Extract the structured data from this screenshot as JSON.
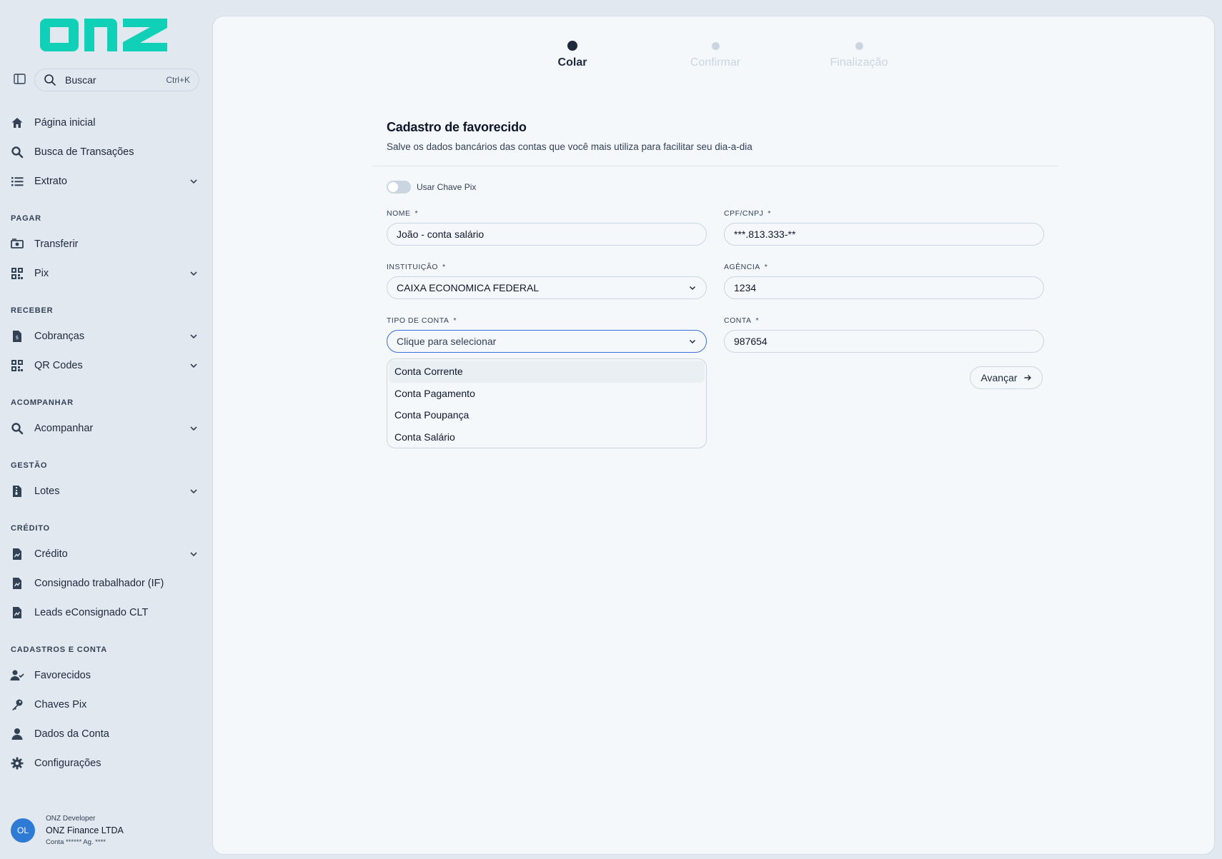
{
  "brand": {
    "logo_text": "onz",
    "logo_color": "#10d0b8"
  },
  "search": {
    "label": "Buscar",
    "shortcut": "Ctrl+K"
  },
  "sidebar": {
    "items_top": [
      {
        "label": "Página inicial",
        "icon": "home-icon"
      },
      {
        "label": "Busca de Transações",
        "icon": "search-icon"
      },
      {
        "label": "Extrato",
        "icon": "list-icon",
        "expandable": true
      }
    ],
    "sections": [
      {
        "title": "PAGAR",
        "items": [
          {
            "label": "Transferir",
            "icon": "money-icon"
          },
          {
            "label": "Pix",
            "icon": "qr-icon",
            "expandable": true
          }
        ]
      },
      {
        "title": "RECEBER",
        "items": [
          {
            "label": "Cobranças",
            "icon": "invoice-icon",
            "expandable": true
          },
          {
            "label": "QR Codes",
            "icon": "qr-icon",
            "expandable": true
          }
        ]
      },
      {
        "title": "ACOMPANHAR",
        "items": [
          {
            "label": "Acompanhar",
            "icon": "search-icon",
            "expandable": true
          }
        ]
      },
      {
        "title": "GESTÃO",
        "items": [
          {
            "label": "Lotes",
            "icon": "file-zip-icon",
            "expandable": true
          }
        ]
      },
      {
        "title": "CRÉDITO",
        "items": [
          {
            "label": "Crédito",
            "icon": "file-chart-icon",
            "expandable": true
          },
          {
            "label": "Consignado trabalhador (IF)",
            "icon": "file-chart-icon"
          },
          {
            "label": "Leads eConsignado CLT",
            "icon": "file-chart-icon"
          }
        ]
      },
      {
        "title": "CADASTROS E CONTA",
        "items": [
          {
            "label": "Favorecidos",
            "icon": "user-check-icon"
          },
          {
            "label": "Chaves Pix",
            "icon": "key-icon"
          },
          {
            "label": "Dados da Conta",
            "icon": "user-icon"
          },
          {
            "label": "Configurações",
            "icon": "gear-icon"
          }
        ]
      }
    ]
  },
  "user": {
    "initials": "OL",
    "role": "ONZ Developer",
    "company": "ONZ Finance LTDA",
    "account": "Conta ****** Ag. ****",
    "avatar_color": "#2e7bd6"
  },
  "stepper": {
    "steps": [
      {
        "label": "Colar",
        "active": true
      },
      {
        "label": "Confirmar",
        "active": false
      },
      {
        "label": "Finalização",
        "active": false
      }
    ]
  },
  "form": {
    "title": "Cadastro de favorecido",
    "subtitle": "Salve os dados bancários das contas que você mais utiliza para facilitar seu dia-a-dia",
    "pix_toggle_label": "Usar Chave Pix",
    "pix_toggle_on": false,
    "required_mark": "*",
    "fields": {
      "nome": {
        "label": "NOME",
        "value": "João - conta salário"
      },
      "cpf": {
        "label": "CPF/CNPJ",
        "value": "***.813.333-**"
      },
      "instituicao": {
        "label": "INSTITUIÇÃO",
        "value": "CAIXA ECONOMICA FEDERAL"
      },
      "agencia": {
        "label": "AGÊNCIA",
        "value": "1234"
      },
      "tipo_conta": {
        "label": "TIPO DE CONTA",
        "placeholder": "Clique para selecionar"
      },
      "conta": {
        "label": "CONTA",
        "value": "987654"
      }
    },
    "account_type_options": [
      "Conta Corrente",
      "Conta Pagamento",
      "Conta Poupança",
      "Conta Salário"
    ],
    "advance_label": "Avançar"
  }
}
